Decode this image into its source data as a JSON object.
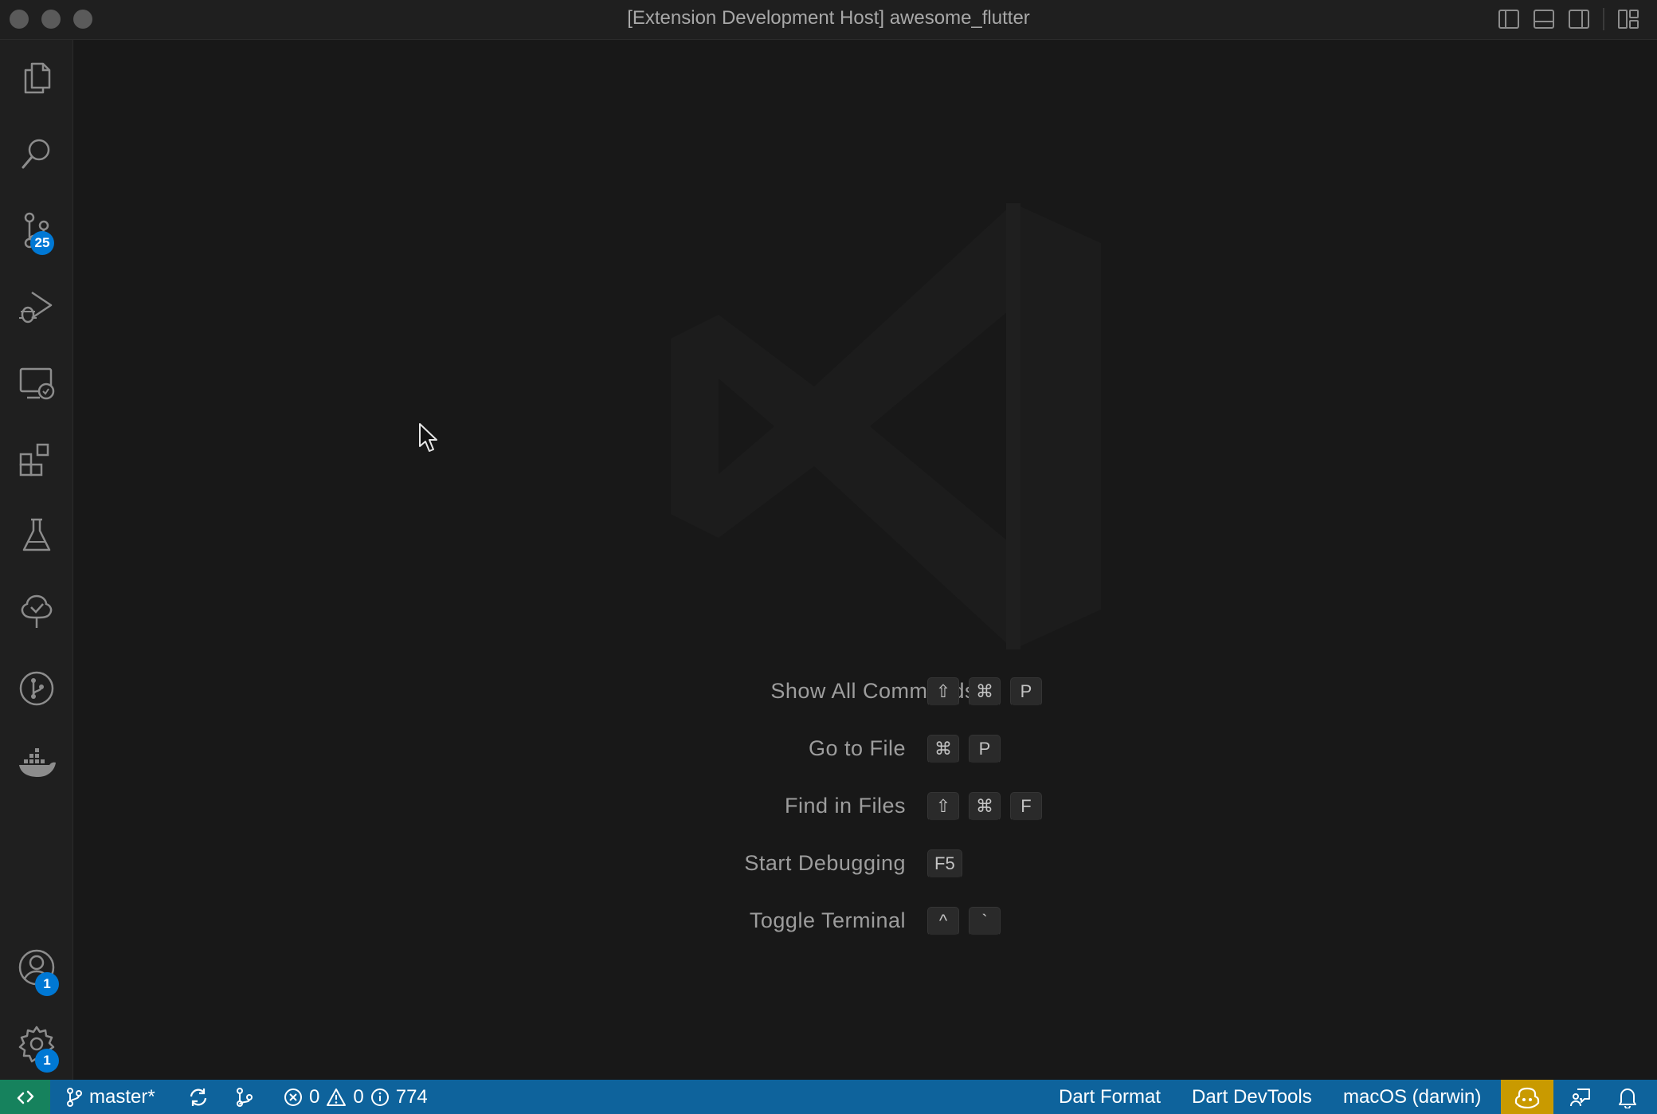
{
  "window": {
    "title": "[Extension Development Host] awesome_flutter"
  },
  "activity_bar": {
    "items": [
      {
        "name": "explorer",
        "icon": "files-icon"
      },
      {
        "name": "search",
        "icon": "search-icon"
      },
      {
        "name": "source-control",
        "icon": "source-control-icon",
        "badge": "25"
      },
      {
        "name": "run-debug",
        "icon": "run-debug-icon"
      },
      {
        "name": "remote-explorer",
        "icon": "remote-explorer-icon"
      },
      {
        "name": "extensions",
        "icon": "extensions-icon"
      },
      {
        "name": "testing",
        "icon": "beaker-icon"
      },
      {
        "name": "flutter-outline",
        "icon": "tree-check-icon"
      },
      {
        "name": "git-graph",
        "icon": "git-graph-icon"
      },
      {
        "name": "docker",
        "icon": "docker-icon"
      }
    ],
    "accounts_badge": "1",
    "manage_badge": "1"
  },
  "editor": {
    "shortcuts": [
      {
        "label": "Show All Commands",
        "keys": [
          "⇧",
          "⌘",
          "P"
        ]
      },
      {
        "label": "Go to File",
        "keys": [
          "⌘",
          "P"
        ]
      },
      {
        "label": "Find in Files",
        "keys": [
          "⇧",
          "⌘",
          "F"
        ]
      },
      {
        "label": "Start Debugging",
        "keys": [
          "F5"
        ]
      },
      {
        "label": "Toggle Terminal",
        "keys": [
          "^",
          "`"
        ]
      }
    ]
  },
  "status_bar": {
    "branch": "master*",
    "errors": "0",
    "warnings": "0",
    "infos": "774",
    "dart_format": "Dart Format",
    "dart_devtools": "Dart DevTools",
    "device": "macOS (darwin)"
  },
  "colors": {
    "statusbar": "#0e639c",
    "remote": "#16825d",
    "badge": "#0078d4",
    "copilot": "#c99a00"
  }
}
